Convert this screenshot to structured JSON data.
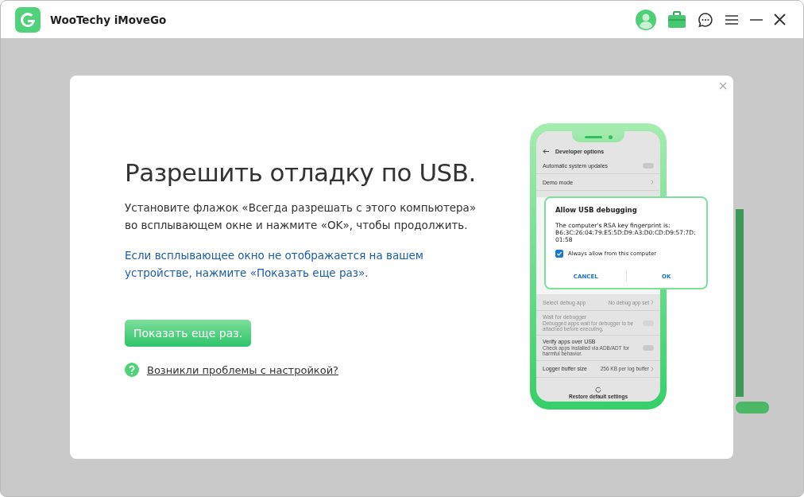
{
  "app": {
    "title": "WooTechy iMoveGo"
  },
  "modal": {
    "heading": "Разрешить отладку по USB.",
    "instruction": "Установите флажок «Всегда разрешать с этого компьютера» во всплывающем окне и нажмите «OK», чтобы продолжить.",
    "hint": "Если всплывающее окно не отображается на вашем устройстве, нажмите «Показать еще раз».",
    "button": "Показать еще раз.",
    "help_link": "Возникли проблемы с настройкой?"
  },
  "phone": {
    "screen_title": "Developer options",
    "settings_top": [
      {
        "kind": "toggle",
        "label": "Automatic system updates",
        "on": false,
        "disabled": false
      },
      {
        "kind": "link",
        "label": "Demo mode",
        "disabled": false
      }
    ],
    "settings_bottom": [
      {
        "kind": "link",
        "label": "Select debug app",
        "value": "No debug app set",
        "disabled": true
      },
      {
        "kind": "toggle",
        "label": "Wait for debugger",
        "description": "Debugged apps wait for debugger to be attached before executing.",
        "on": false,
        "disabled": true
      },
      {
        "kind": "toggle",
        "label": "Verify apps over USB",
        "description": "Check apps installed via ADB/ADT for harmful behavior.",
        "on": false,
        "disabled": false
      },
      {
        "kind": "link",
        "label": "Logger buffer size",
        "value": "256 KB per log buffer",
        "disabled": false
      }
    ],
    "footer": "Restore default settings",
    "dialog": {
      "title": "Allow USB debugging",
      "message": "The computer's RSA key fingerprint is:",
      "fingerprint": "B6:3C:26:04:79:E5:5D:D9:A3:D0:CD:D9:57:7D:01:58",
      "checkbox": {
        "label": "Always allow from this computer",
        "checked": true
      },
      "buttons": [
        "CANCEL",
        "OK"
      ]
    }
  }
}
